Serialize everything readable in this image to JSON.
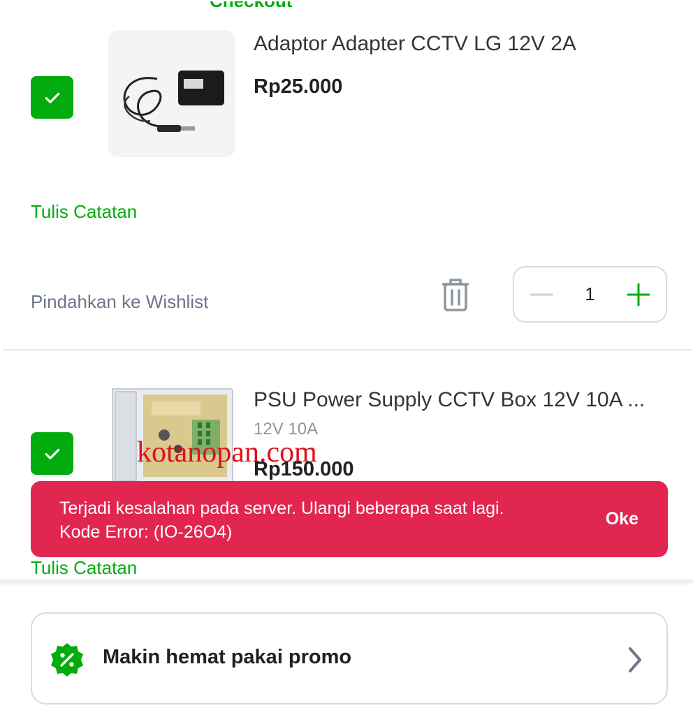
{
  "top_partial_text": "Checkout",
  "items": [
    {
      "name": "Adaptor Adapter CCTV LG 12V 2A",
      "variant": "",
      "price": "Rp25.000",
      "note_link": "Tulis Catatan",
      "wishlist_link": "Pindahkan ke Wishlist",
      "quantity": "1",
      "checked": true
    },
    {
      "name": "PSU Power Supply CCTV Box 12V 10A ...",
      "variant": "12V 10A",
      "price": "Rp150.000",
      "note_link": "Tulis Catatan",
      "checked": true
    }
  ],
  "watermark": "kotanopan.com",
  "toast": {
    "line1": "Terjadi kesalahan pada server. Ulangi beberapa saat lagi.",
    "line2": "Kode Error: (IO-26O4)",
    "action": "Oke"
  },
  "promo": {
    "label": "Makin hemat pakai promo"
  },
  "colors": {
    "accent": "#03ac0e",
    "toast_bg": "#e1264f",
    "text": "#31353b",
    "muted": "#6d7588"
  },
  "icons": [
    "check-icon",
    "trash-icon",
    "minus-icon",
    "plus-icon",
    "promo-discount-icon",
    "chevron-right-icon"
  ]
}
